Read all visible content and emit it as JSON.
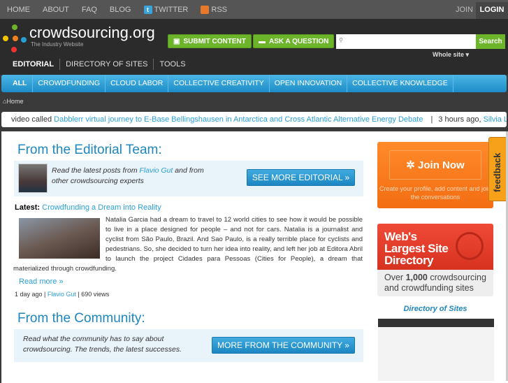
{
  "topbar": {
    "items": [
      "HOME",
      "ABOUT",
      "FAQ",
      "BLOG",
      "TWITTER",
      "RSS"
    ],
    "join": "JOIN",
    "login": "LOGIN"
  },
  "header": {
    "logo_name": "crowdsourcing.org",
    "logo_tagline": "The Industry Website",
    "submit": "SUBMIT CONTENT",
    "ask": "ASK A QUESTION",
    "search_placeholder": "",
    "search_button": "Search",
    "scope": "Whole site ▾"
  },
  "tabs": [
    "EDITORIAL",
    "DIRECTORY OF SITES",
    "TOOLS"
  ],
  "nav": [
    "ALL",
    "CROWDFUNDING",
    "CLOUD LABOR",
    "COLLECTIVE CREATIVITY",
    "OPEN INNOVATION",
    "COLLECTIVE KNOWLEDGE"
  ],
  "breadcrumb": "Home",
  "ticker": {
    "prefix": "video called ",
    "link": "Dabblerr virtual journey to E-Base Bellingshausen in Antarctica and Cross Atlantic Alternative Energy Debate",
    "sep": "|",
    "time": "3 hours ago, ",
    "author": "Silvia L"
  },
  "editorial": {
    "title": "From the Editorial Team:",
    "intro_pre": "Read the latest posts from ",
    "intro_link": "Flavio Gut",
    "intro_post": " and from other crowdsourcing experts",
    "button": "SEE MORE EDITORIAL »",
    "latest_label": "Latest:",
    "latest_title": "Crowdfunding a Dream into Reality",
    "body": "Natalia Garcia had a dream to travel to 12 world cities to see how it would be possible to live in a place designed for people – and not for cars. Natalia is a journalist and cyclist from São Paulo, Brazil. And Sao Paulo,  is a really terrible place for cyclists and pedestrians. So, she decided to turn her idea into reality, and left her job at Editora Abril to launch the project Cidades para Pessoas (Cities for People), a dream that materialized through crowdfunding.",
    "read_more": "Read more »",
    "meta_time": "1 day ago",
    "meta_author": "Flavio Gut",
    "meta_views": "690 views"
  },
  "community": {
    "title": "From the Community:",
    "intro": "Read what the community has to say about crowdsourcing. The trends, the latest successes.",
    "button": "MORE FROM THE COMMUNITY »"
  },
  "sidebar": {
    "join": "Join Now",
    "join_sub": "Create your profile, add content and join the conversations",
    "dir_title": "Web's Largest Site Directory",
    "dir_sub_pre": "Over ",
    "dir_sub_num": "1,000",
    "dir_sub_post": " crowdsourcing and crowdfunding sites",
    "dir_link": "Directory of Sites"
  },
  "feedback": "feedback"
}
